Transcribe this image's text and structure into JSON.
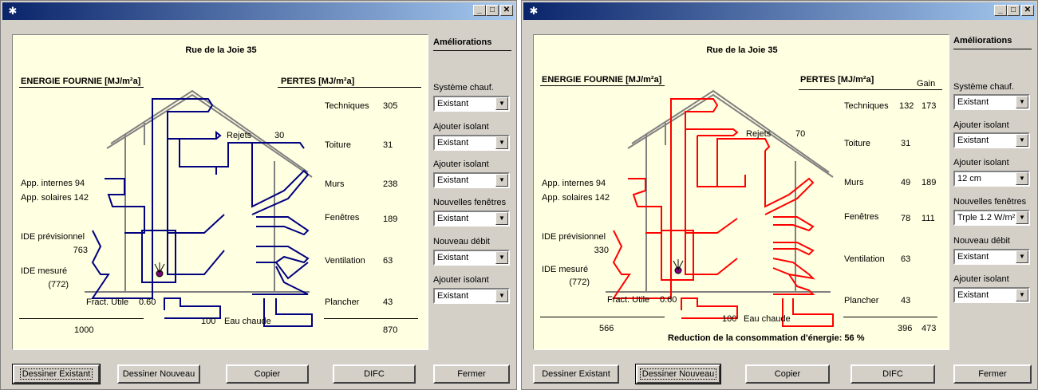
{
  "windows": [
    {
      "id": "left",
      "title": "",
      "address": "Rue de la Joie 35",
      "energie_title": "ENERGIE FOURNIE [MJ/m²a]",
      "pertes_title": "PERTES [MJ/m²a]",
      "gain_header": "",
      "rejets_label": "Rejets",
      "rejets_value": "30",
      "app_internes": "App. internes 94",
      "app_solaires": "App. solaires 142",
      "ide_prev_label": "IDE prévisionnel",
      "ide_prev_value": "763",
      "ide_mes_label": "IDE mesuré",
      "ide_mes_value": "(772)",
      "fract_label": "Fract. Utile",
      "fract_value": "0.60",
      "eau_value": "100",
      "eau_label": "Eau chaude",
      "total_in": "1000",
      "total_out": "870",
      "total_gain": "",
      "reduction": "",
      "losses": [
        {
          "label": "Techniques",
          "value": "305",
          "gain": ""
        },
        {
          "label": "Toiture",
          "value": "31",
          "gain": ""
        },
        {
          "label": "Murs",
          "value": "238",
          "gain": ""
        },
        {
          "label": "Fenêtres",
          "value": "189",
          "gain": ""
        },
        {
          "label": "Ventilation",
          "value": "63",
          "gain": ""
        },
        {
          "label": "Plancher",
          "value": "43",
          "gain": ""
        }
      ],
      "ameliorations_title": "Améliorations",
      "options": [
        {
          "label": "Système chauf.",
          "value": "Existant"
        },
        {
          "label": "Ajouter isolant",
          "value": "Existant"
        },
        {
          "label": "Ajouter isolant",
          "value": "Existant"
        },
        {
          "label": "Nouvelles fenêtres",
          "value": "Existant"
        },
        {
          "label": "Nouveau débit",
          "value": "Existant"
        },
        {
          "label": "Ajouter isolant",
          "value": "Existant"
        }
      ],
      "buttons": {
        "dessiner_existant": "Dessiner Existant",
        "dessiner_nouveau": "Dessiner Nouveau",
        "copier": "Copier",
        "difc": "DIFC",
        "fermer": "Fermer"
      },
      "flow_color": "#000080",
      "default_button": "existant"
    },
    {
      "id": "right",
      "title": "",
      "address": "Rue de la Joie 35",
      "energie_title": "ENERGIE FOURNIE [MJ/m²a]",
      "pertes_title": "PERTES [MJ/m²a]",
      "gain_header": "Gain",
      "rejets_label": "Rejets",
      "rejets_value": "70",
      "app_internes": "App. internes 94",
      "app_solaires": "App. solaires 142",
      "ide_prev_label": "IDE prévisionnel",
      "ide_prev_value": "330",
      "ide_mes_label": "IDE mesuré",
      "ide_mes_value": "(772)",
      "fract_label": "Fract. Utile",
      "fract_value": "0.60",
      "eau_value": "100",
      "eau_label": "Eau chaude",
      "total_in": "566",
      "total_out": "396",
      "total_gain": "473",
      "reduction": "Reduction de la consommation d'énergie: 56 %",
      "losses": [
        {
          "label": "Techniques",
          "value": "132",
          "gain": "173"
        },
        {
          "label": "Toiture",
          "value": "31",
          "gain": ""
        },
        {
          "label": "Murs",
          "value": "49",
          "gain": "189"
        },
        {
          "label": "Fenêtres",
          "value": "78",
          "gain": "111"
        },
        {
          "label": "Ventilation",
          "value": "63",
          "gain": ""
        },
        {
          "label": "Plancher",
          "value": "43",
          "gain": ""
        }
      ],
      "ameliorations_title": "Améliorations",
      "options": [
        {
          "label": "Système chauf.",
          "value": "Existant"
        },
        {
          "label": "Ajouter isolant",
          "value": "Existant"
        },
        {
          "label": "Ajouter isolant",
          "value": "12 cm"
        },
        {
          "label": "Nouvelles fenêtres",
          "value": "Trple 1.2 W/m²"
        },
        {
          "label": "Nouveau débit",
          "value": "Existant"
        },
        {
          "label": "Ajouter isolant",
          "value": "Existant"
        }
      ],
      "buttons": {
        "dessiner_existant": "Dessiner Existant",
        "dessiner_nouveau": "Dessiner Nouveau",
        "copier": "Copier",
        "difc": "DIFC",
        "fermer": "Fermer"
      },
      "flow_color": "#ff0000",
      "default_button": "nouveau"
    }
  ]
}
